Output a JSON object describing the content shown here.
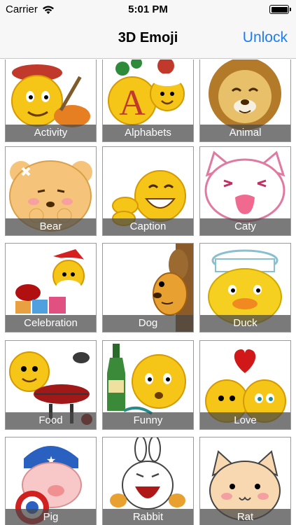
{
  "status_bar": {
    "carrier": "Carrier",
    "time": "5:01 PM"
  },
  "nav": {
    "title": "3D Emoji",
    "action_label": "Unlock",
    "accent_color": "#1e7cf5"
  },
  "categories": [
    {
      "label": "Activity",
      "icon": "painter-emoji-icon"
    },
    {
      "label": "Alphabets",
      "icon": "letter-emoji-icon"
    },
    {
      "label": "Animal",
      "icon": "lion-emoji-icon"
    },
    {
      "label": "Bear",
      "icon": "bear-emoji-icon"
    },
    {
      "label": "Caption",
      "icon": "laughing-emoji-icon"
    },
    {
      "label": "Caty",
      "icon": "cat-emoji-icon"
    },
    {
      "label": "Celebration",
      "icon": "santa-emoji-icon"
    },
    {
      "label": "Dog",
      "icon": "dog-emoji-icon"
    },
    {
      "label": "Duck",
      "icon": "duck-emoji-icon"
    },
    {
      "label": "Food",
      "icon": "grill-emoji-icon"
    },
    {
      "label": "Funny",
      "icon": "bottle-emoji-icon"
    },
    {
      "label": "Love",
      "icon": "couple-heart-emoji-icon"
    },
    {
      "label": "Pig",
      "icon": "pig-emoji-icon"
    },
    {
      "label": "Rabbit",
      "icon": "rabbit-emoji-icon"
    },
    {
      "label": "Rat",
      "icon": "rat-emoji-icon"
    }
  ]
}
